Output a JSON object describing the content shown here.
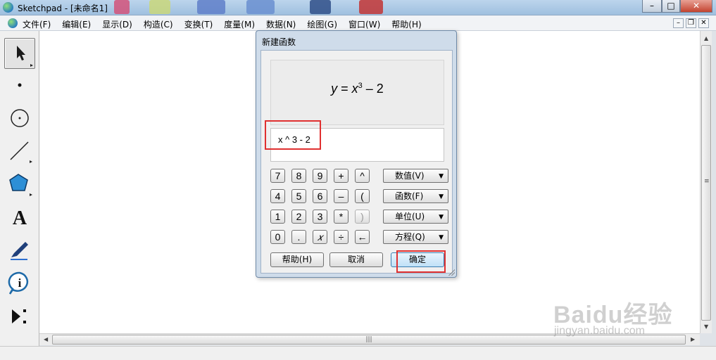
{
  "window": {
    "title": "Sketchpad  - [未命名1]",
    "minimize": "–",
    "maximize": "□",
    "close": "✕"
  },
  "menu": [
    "文件(F)",
    "编辑(E)",
    "显示(D)",
    "构造(C)",
    "变换(T)",
    "度量(M)",
    "数据(N)",
    "绘图(G)",
    "窗口(W)",
    "帮助(H)"
  ],
  "mdi": {
    "minimize": "–",
    "restore": "❐",
    "close": "✕"
  },
  "toolbox": [
    "arrow-tool",
    "point-tool",
    "compass-tool",
    "straightedge-tool",
    "polygon-tool",
    "text-tool",
    "marker-tool",
    "information-tool",
    "custom-tool"
  ],
  "text_tool_glyph": "A",
  "dialog": {
    "title": "新建函数",
    "preview": {
      "y": "y",
      "eq": " = ",
      "x": "x",
      "exp": "3",
      "rest": " – 2"
    },
    "input": "x ^ 3 - 2",
    "keypad": [
      [
        "7",
        "8",
        "9",
        "+",
        "^"
      ],
      [
        "4",
        "5",
        "6",
        "–",
        "("
      ],
      [
        "1",
        "2",
        "3",
        "*",
        ")"
      ],
      [
        "0",
        ".",
        "𝑥",
        "÷",
        "←"
      ]
    ],
    "dropdowns": [
      "数值(V)",
      "函数(F)",
      "单位(U)",
      "方程(Q)"
    ],
    "buttons": {
      "help": "帮助(H)",
      "cancel": "取消",
      "ok": "确定"
    }
  },
  "scrollbar": {
    "grip": "|||",
    "vgrip": "≡"
  },
  "watermark": {
    "logo": "Baidu经验",
    "url": "jingyan.baidu.com"
  }
}
